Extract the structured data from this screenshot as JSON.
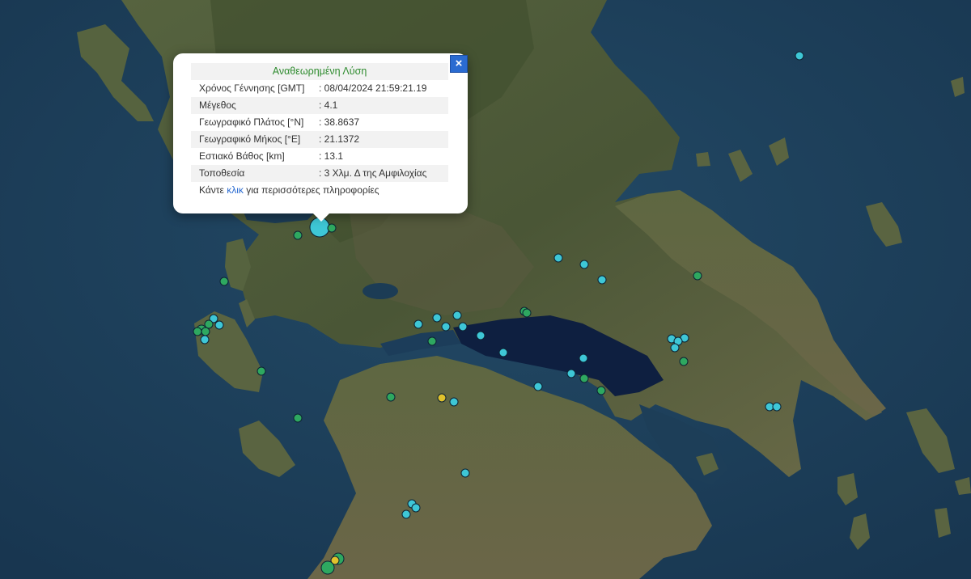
{
  "popup": {
    "title": "Αναθεωρημένη Λύση",
    "close_label": "×",
    "rows": [
      {
        "label": "Χρόνος Γέννησης [GMT]",
        "value": ": 08/04/2024 21:59:21.19"
      },
      {
        "label": "Μέγεθος",
        "value": ": 4.1"
      },
      {
        "label": "Γεωγραφικό Πλάτος [°N]",
        "value": ": 38.8637"
      },
      {
        "label": "Γεωγραφικό Μήκος [°E]",
        "value": ": 21.1372"
      },
      {
        "label": "Εστιακό Βάθος [km]",
        "value": ": 13.1"
      },
      {
        "label": "Τοποθεσία",
        "value": ": 3 Χλμ. Δ της Αμφιλοχίας"
      }
    ],
    "more_prefix": "Κάντε ",
    "more_link": "κλικ",
    "more_suffix": " για περισσότερες πληροφορίες"
  },
  "colors": {
    "sea": "#1d3e58",
    "land": "#4b5a3a",
    "marker_cyan": "#3ec7d6",
    "marker_green": "#2ea860",
    "marker_yellow": "#e0c22c",
    "close_button": "#2a6bd1"
  }
}
